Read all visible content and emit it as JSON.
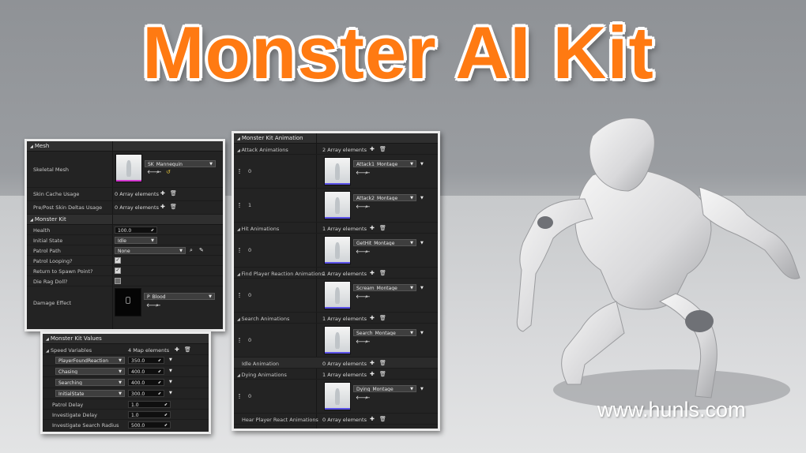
{
  "title": "Monster AI Kit",
  "watermark": "www.hunls.com",
  "mesh_panel": {
    "mesh_header": "Mesh",
    "skeletal_mesh_label": "Skeletal Mesh",
    "skeletal_mesh_value": "SK_Mannequin",
    "skin_cache_label": "Skin Cache Usage",
    "skin_cache_value": "0 Array elements",
    "pre_post_label": "Pre/Post Skin Deltas Usage",
    "pre_post_value": "0 Array elements",
    "monster_kit_header": "Monster Kit",
    "health_label": "Health",
    "health_value": "100.0",
    "initial_state_label": "Initial State",
    "initial_state_value": "Idle",
    "patrol_path_label": "Patrol Path",
    "patrol_path_value": "None",
    "patrol_looping_label": "Patrol Looping?",
    "patrol_looping_checked": true,
    "return_spawn_label": "Return to Spawn Point?",
    "return_spawn_checked": true,
    "die_ragdoll_label": "Die Rag Doll?",
    "die_ragdoll_checked": false,
    "damage_effect_label": "Damage Effect",
    "damage_effect_value": "P_Blood"
  },
  "values_panel": {
    "header": "Monster Kit Values",
    "speed_label": "Speed Variables",
    "speed_count": "4 Map elements",
    "speed_entries": [
      {
        "key": "PlayerFoundReaction",
        "value": "350.0"
      },
      {
        "key": "Chasing",
        "value": "400.0"
      },
      {
        "key": "Searching",
        "value": "400.0"
      },
      {
        "key": "InitialState",
        "value": "300.0"
      }
    ],
    "patrol_delay_label": "Patrol Delay",
    "patrol_delay_value": "1.0",
    "investigate_delay_label": "Investigate Delay",
    "investigate_delay_value": "1.0",
    "investigate_radius_label": "Investigate Search Radius",
    "investigate_radius_value": "500.0"
  },
  "anim_panel": {
    "header": "Monster Kit Animation",
    "attack_label": "Attack Animations",
    "attack_count": "2 Array elements",
    "attack_items": [
      {
        "index": "0",
        "name": "Attack1_Montage"
      },
      {
        "index": "1",
        "name": "Attack2_Montage"
      }
    ],
    "hit_label": "Hit Animations",
    "hit_count": "1 Array elements",
    "hit_items": [
      {
        "index": "0",
        "name": "GetHit_Montage"
      }
    ],
    "find_label": "Find Player Reaction Animations",
    "find_count": "1 Array elements",
    "find_items": [
      {
        "index": "0",
        "name": "Scream_Montage"
      }
    ],
    "search_label": "Search Animations",
    "search_count": "1 Array elements",
    "search_items": [
      {
        "index": "0",
        "name": "Search_Montage"
      }
    ],
    "idle_label": "Idle Animation",
    "idle_count": "0 Array elements",
    "dying_label": "Dying Animations",
    "dying_count": "1 Array elements",
    "dying_items": [
      {
        "index": "0",
        "name": "Dying_Montage"
      }
    ],
    "hear_label": "Hear Player React Animations",
    "hear_count": "0 Array elements"
  },
  "colors": {
    "title_orange": "#ff7a12",
    "panel_bg": "#232323",
    "thumb_bar": "#5b52e8"
  },
  "icons": [
    "plus-icon",
    "trash-icon",
    "arrow-left-icon",
    "search-icon",
    "pick-icon",
    "reset-icon",
    "chevron-down-icon"
  ]
}
